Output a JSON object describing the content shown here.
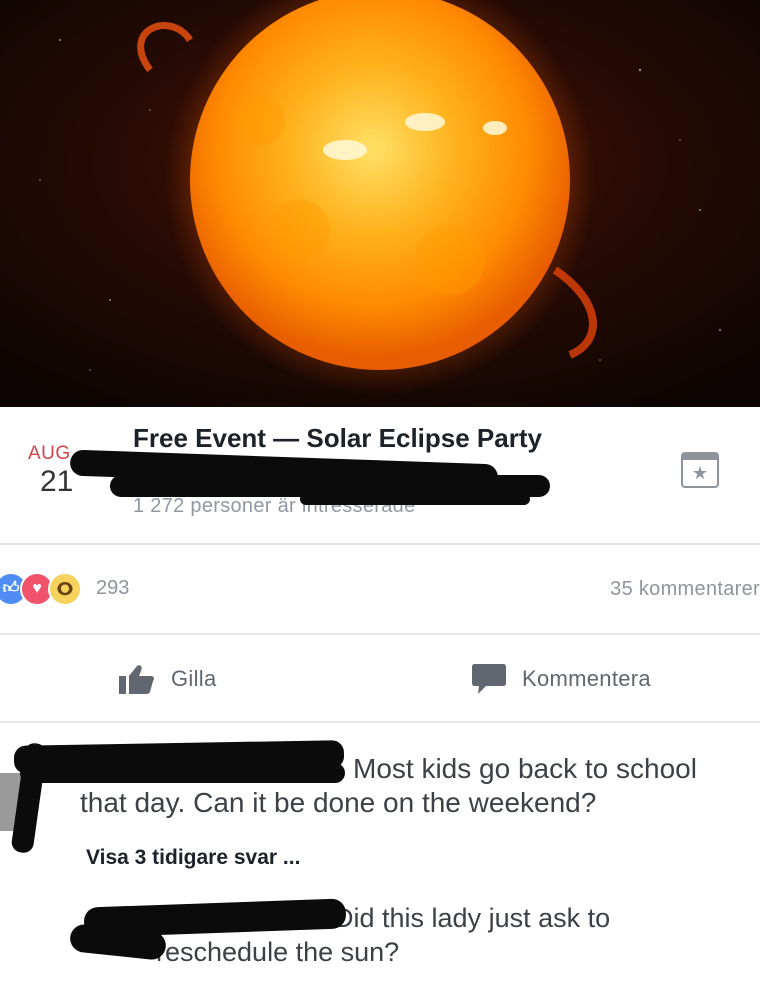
{
  "event": {
    "date_month": "AUG.",
    "date_day": "21",
    "title": "Free Event — Solar Eclipse Party",
    "subtitle": "1 272 personer är intresserade"
  },
  "reactions": {
    "icons": [
      "like-icon",
      "love-icon",
      "wow-icon"
    ],
    "count": "293",
    "comments_count": "35 kommentarer"
  },
  "actions": {
    "like_label": "Gilla",
    "comment_label": "Kommentera"
  },
  "comments": {
    "first_line1": "Most kids go back to school",
    "first_line2": "that day. Can it be done on the weekend?",
    "view_more": "Visa 3 tidigare svar ...",
    "reply_line1": "Did this lady just ask to",
    "reply_line2": "reschedule the sun?"
  },
  "colors": {
    "date_month": "#d3434a",
    "like": "#4f8df5",
    "love": "#f0536b",
    "wow": "#f7d25c",
    "muted_text": "#90949c"
  }
}
